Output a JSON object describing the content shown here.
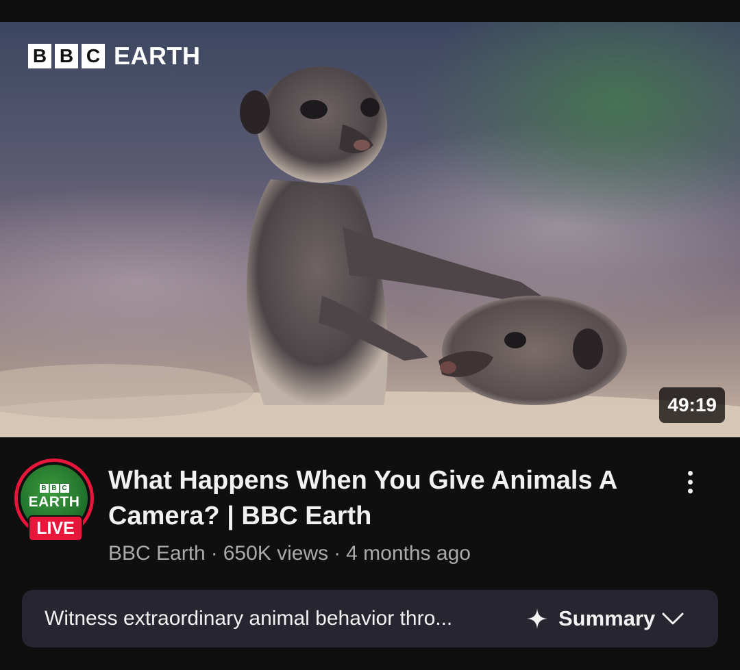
{
  "thumbnail": {
    "brand_letters": [
      "B",
      "B",
      "C"
    ],
    "brand_word": "EARTH",
    "duration": "49:19"
  },
  "channel": {
    "avatar_letters": [
      "B",
      "B",
      "C"
    ],
    "avatar_word": "EARTH",
    "live_label": "LIVE",
    "ring_color": "#e8163a"
  },
  "video": {
    "title": "What Happens When You Give Animals A Camera? | BBC Earth",
    "channel_name": "BBC Earth",
    "views": "650K views",
    "age": "4 months ago",
    "separator": "·"
  },
  "summary": {
    "text": "Witness extraordinary animal behavior thro...",
    "label": "Summary",
    "icon": "sparkle-icon",
    "expand_icon": "chevron-down-icon"
  },
  "colors": {
    "background": "#0f0f0f",
    "summary_bar": "#272630",
    "meta_text": "#aaaaaa",
    "live": "#e8163a"
  }
}
